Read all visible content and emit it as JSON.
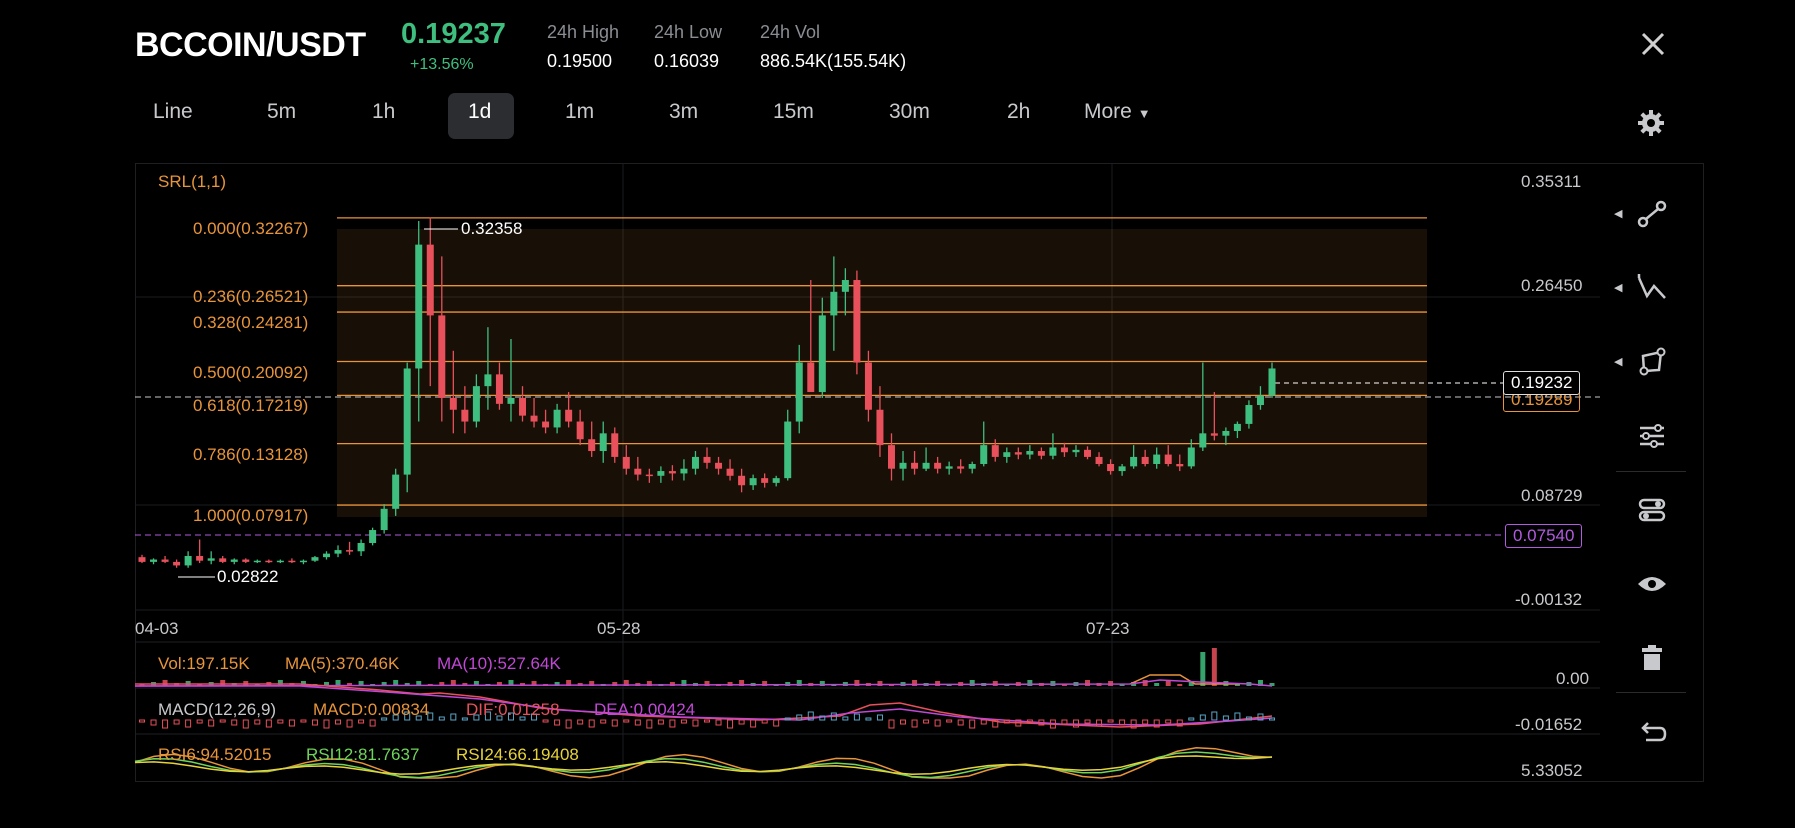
{
  "header": {
    "pair": "BCCOIN/USDT",
    "price": "0.19237",
    "change": "+13.56%",
    "stats": [
      {
        "label": "24h High",
        "value": "0.19500"
      },
      {
        "label": "24h Low",
        "value": "0.16039"
      },
      {
        "label": "24h Vol",
        "value": "886.54K(155.54K)"
      }
    ]
  },
  "timeframes": [
    "Line",
    "5m",
    "1h",
    "1d",
    "1m",
    "3m",
    "15m",
    "30m",
    "2h",
    "More"
  ],
  "active_timeframe": "1d",
  "indicator_label": "SRL(1,1)",
  "fib_levels": [
    {
      "label": "0.000(0.32267)",
      "value": 0.32267
    },
    {
      "label": "0.236(0.26521)",
      "value": 0.26521
    },
    {
      "label": "0.328(0.24281)",
      "value": 0.24281
    },
    {
      "label": "0.500(0.20092)",
      "value": 0.20092
    },
    {
      "label": "0.618(0.17219)",
      "value": 0.17219
    },
    {
      "label": "0.786(0.13128)",
      "value": 0.13128
    },
    {
      "label": "1.000(0.07917)",
      "value": 0.07917
    }
  ],
  "high_marker": "0.32358",
  "low_marker": "0.02822",
  "y_axis": [
    "0.35311",
    "0.26450",
    "0.08729",
    "-0.00132"
  ],
  "x_axis": [
    "04-03",
    "05-28",
    "07-23"
  ],
  "price_tag": "0.19232",
  "price_tag_under": "0.19289",
  "line_tag": "0.07540",
  "volume": {
    "vol": "Vol:197.15K",
    "ma5": "MA(5):370.46K",
    "ma10": "MA(10):527.64K",
    "axis": "0.00"
  },
  "macd": {
    "name": "MACD(12,26,9)",
    "macd": "MACD:0.00834",
    "dif": "DIF:0.01258",
    "dea": "DEA:0.00424",
    "axis": "-0.01652"
  },
  "rsi": {
    "rsi6": "RSI6:94.52015",
    "rsi12": "RSI12:81.7637",
    "rsi24": "RSI24:66.19408",
    "axis": "5.33052"
  },
  "sidebar_tools": [
    "trend-line-icon",
    "wave-icon",
    "shape-icon",
    "settings-sliders-icon",
    "indicator-toggle-icon",
    "eye-icon",
    "trash-icon",
    "undo-icon"
  ],
  "colors": {
    "up": "#3fbf7f",
    "down": "#e8505b",
    "fib": "#e8943a",
    "purple": "#b25be0"
  },
  "chart_data": {
    "type": "candlestick",
    "ylim": [
      -0.00132,
      0.35311
    ],
    "x": [
      "04-03",
      "05-28",
      "07-23"
    ],
    "candles": [
      [
        0.035,
        0.037,
        0.03,
        0.031
      ],
      [
        0.031,
        0.034,
        0.029,
        0.033
      ],
      [
        0.033,
        0.036,
        0.03,
        0.031
      ],
      [
        0.031,
        0.033,
        0.026,
        0.028
      ],
      [
        0.028,
        0.04,
        0.026,
        0.036
      ],
      [
        0.036,
        0.05,
        0.03,
        0.032
      ],
      [
        0.032,
        0.04,
        0.029,
        0.034
      ],
      [
        0.034,
        0.036,
        0.03,
        0.031
      ],
      [
        0.031,
        0.034,
        0.029,
        0.033
      ],
      [
        0.033,
        0.034,
        0.03,
        0.031
      ],
      [
        0.031,
        0.033,
        0.03,
        0.032
      ],
      [
        0.032,
        0.033,
        0.03,
        0.031
      ],
      [
        0.031,
        0.033,
        0.03,
        0.032
      ],
      [
        0.032,
        0.034,
        0.03,
        0.031
      ],
      [
        0.031,
        0.033,
        0.029,
        0.032
      ],
      [
        0.032,
        0.036,
        0.031,
        0.035
      ],
      [
        0.035,
        0.04,
        0.033,
        0.038
      ],
      [
        0.038,
        0.045,
        0.035,
        0.041
      ],
      [
        0.041,
        0.048,
        0.037,
        0.04
      ],
      [
        0.04,
        0.05,
        0.036,
        0.047
      ],
      [
        0.047,
        0.06,
        0.045,
        0.058
      ],
      [
        0.058,
        0.08,
        0.055,
        0.076
      ],
      [
        0.076,
        0.11,
        0.07,
        0.105
      ],
      [
        0.105,
        0.2,
        0.09,
        0.195
      ],
      [
        0.195,
        0.32,
        0.15,
        0.3
      ],
      [
        0.3,
        0.323,
        0.18,
        0.24
      ],
      [
        0.24,
        0.29,
        0.15,
        0.17
      ],
      [
        0.17,
        0.21,
        0.14,
        0.16
      ],
      [
        0.16,
        0.18,
        0.14,
        0.15
      ],
      [
        0.15,
        0.19,
        0.145,
        0.18
      ],
      [
        0.18,
        0.23,
        0.16,
        0.19
      ],
      [
        0.19,
        0.2,
        0.16,
        0.165
      ],
      [
        0.165,
        0.22,
        0.15,
        0.17
      ],
      [
        0.17,
        0.18,
        0.15,
        0.155
      ],
      [
        0.155,
        0.17,
        0.145,
        0.15
      ],
      [
        0.15,
        0.16,
        0.14,
        0.145
      ],
      [
        0.145,
        0.165,
        0.14,
        0.16
      ],
      [
        0.16,
        0.175,
        0.145,
        0.15
      ],
      [
        0.15,
        0.16,
        0.13,
        0.135
      ],
      [
        0.135,
        0.15,
        0.12,
        0.125
      ],
      [
        0.125,
        0.15,
        0.115,
        0.14
      ],
      [
        0.14,
        0.145,
        0.115,
        0.12
      ],
      [
        0.12,
        0.13,
        0.105,
        0.11
      ],
      [
        0.11,
        0.12,
        0.1,
        0.105
      ],
      [
        0.105,
        0.11,
        0.098,
        0.104
      ],
      [
        0.104,
        0.112,
        0.098,
        0.108
      ],
      [
        0.108,
        0.113,
        0.1,
        0.106
      ],
      [
        0.106,
        0.118,
        0.1,
        0.11
      ],
      [
        0.11,
        0.125,
        0.105,
        0.12
      ],
      [
        0.12,
        0.128,
        0.11,
        0.115
      ],
      [
        0.115,
        0.12,
        0.105,
        0.11
      ],
      [
        0.11,
        0.118,
        0.1,
        0.104
      ],
      [
        0.104,
        0.11,
        0.09,
        0.096
      ],
      [
        0.096,
        0.105,
        0.092,
        0.102
      ],
      [
        0.102,
        0.106,
        0.094,
        0.098
      ],
      [
        0.098,
        0.104,
        0.095,
        0.102
      ],
      [
        0.102,
        0.16,
        0.1,
        0.15
      ],
      [
        0.15,
        0.215,
        0.14,
        0.2
      ],
      [
        0.2,
        0.27,
        0.18,
        0.175
      ],
      [
        0.175,
        0.255,
        0.17,
        0.24
      ],
      [
        0.24,
        0.29,
        0.21,
        0.26
      ],
      [
        0.26,
        0.28,
        0.24,
        0.27
      ],
      [
        0.27,
        0.278,
        0.19,
        0.2
      ],
      [
        0.2,
        0.21,
        0.15,
        0.16
      ],
      [
        0.16,
        0.18,
        0.12,
        0.13
      ],
      [
        0.13,
        0.14,
        0.1,
        0.11
      ],
      [
        0.11,
        0.125,
        0.1,
        0.115
      ],
      [
        0.115,
        0.125,
        0.105,
        0.11
      ],
      [
        0.11,
        0.128,
        0.108,
        0.115
      ],
      [
        0.115,
        0.12,
        0.106,
        0.11
      ],
      [
        0.11,
        0.116,
        0.105,
        0.112
      ],
      [
        0.112,
        0.118,
        0.106,
        0.11
      ],
      [
        0.11,
        0.116,
        0.106,
        0.114
      ],
      [
        0.114,
        0.15,
        0.112,
        0.13
      ],
      [
        0.13,
        0.135,
        0.116,
        0.12
      ],
      [
        0.12,
        0.128,
        0.115,
        0.124
      ],
      [
        0.124,
        0.128,
        0.118,
        0.122
      ],
      [
        0.122,
        0.13,
        0.118,
        0.125
      ],
      [
        0.125,
        0.128,
        0.118,
        0.121
      ],
      [
        0.121,
        0.14,
        0.118,
        0.128
      ],
      [
        0.128,
        0.132,
        0.12,
        0.124
      ],
      [
        0.124,
        0.13,
        0.12,
        0.126
      ],
      [
        0.126,
        0.129,
        0.118,
        0.12
      ],
      [
        0.12,
        0.124,
        0.112,
        0.114
      ],
      [
        0.114,
        0.118,
        0.105,
        0.108
      ],
      [
        0.108,
        0.114,
        0.104,
        0.112
      ],
      [
        0.112,
        0.13,
        0.11,
        0.12
      ],
      [
        0.12,
        0.126,
        0.112,
        0.114
      ],
      [
        0.114,
        0.128,
        0.11,
        0.122
      ],
      [
        0.122,
        0.13,
        0.112,
        0.114
      ],
      [
        0.114,
        0.122,
        0.108,
        0.112
      ],
      [
        0.112,
        0.135,
        0.11,
        0.128
      ],
      [
        0.128,
        0.2,
        0.125,
        0.14
      ],
      [
        0.14,
        0.175,
        0.134,
        0.138
      ],
      [
        0.138,
        0.145,
        0.13,
        0.142
      ],
      [
        0.142,
        0.15,
        0.136,
        0.148
      ],
      [
        0.148,
        0.168,
        0.144,
        0.164
      ],
      [
        0.164,
        0.18,
        0.16,
        0.172
      ],
      [
        0.172,
        0.2,
        0.17,
        0.195
      ]
    ]
  }
}
